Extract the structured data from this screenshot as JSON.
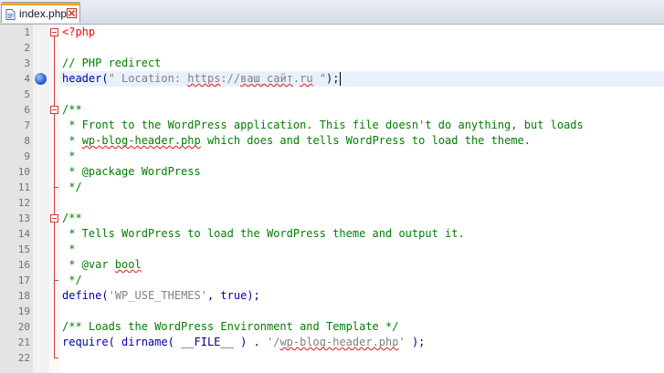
{
  "tab": {
    "label": "index.php"
  },
  "lines": [
    {
      "n": "1",
      "tokens": [
        {
          "t": "<?php",
          "c": "php"
        }
      ]
    },
    {
      "n": "2",
      "tokens": []
    },
    {
      "n": "3",
      "tokens": [
        {
          "t": "// PHP redirect",
          "c": "cmt"
        }
      ]
    },
    {
      "n": "4",
      "tokens": [
        {
          "t": "header",
          "c": "kw"
        },
        {
          "t": "(",
          "c": "op"
        },
        {
          "t": "\" Location: ",
          "c": "str"
        },
        {
          "t": "https",
          "c": "str sq"
        },
        {
          "t": "://",
          "c": "str"
        },
        {
          "t": "ваш_сайт",
          "c": "str sq"
        },
        {
          "t": ".",
          "c": "str"
        },
        {
          "t": "ru",
          "c": "str sq"
        },
        {
          "t": " \"",
          "c": "str"
        },
        {
          "t": ");",
          "c": "op"
        }
      ]
    },
    {
      "n": "5",
      "tokens": []
    },
    {
      "n": "6",
      "tokens": [
        {
          "t": "/**",
          "c": "cmt"
        }
      ]
    },
    {
      "n": "7",
      "tokens": [
        {
          "t": " * Front to the WordPress application. This file doesn't do anything, but loads",
          "c": "cmt"
        }
      ]
    },
    {
      "n": "8",
      "tokens": [
        {
          "t": " * ",
          "c": "cmt"
        },
        {
          "t": "wp-blog-header.php",
          "c": "cmt sq"
        },
        {
          "t": " which does and tells WordPress to load the theme.",
          "c": "cmt"
        }
      ]
    },
    {
      "n": "9",
      "tokens": [
        {
          "t": " *",
          "c": "cmt"
        }
      ]
    },
    {
      "n": "10",
      "tokens": [
        {
          "t": " * @package WordPress",
          "c": "cmt"
        }
      ]
    },
    {
      "n": "11",
      "tokens": [
        {
          "t": " */",
          "c": "cmt"
        }
      ]
    },
    {
      "n": "12",
      "tokens": []
    },
    {
      "n": "13",
      "tokens": [
        {
          "t": "/**",
          "c": "cmt"
        }
      ]
    },
    {
      "n": "14",
      "tokens": [
        {
          "t": " * Tells WordPress to load the WordPress theme and output it.",
          "c": "cmt"
        }
      ]
    },
    {
      "n": "15",
      "tokens": [
        {
          "t": " *",
          "c": "cmt"
        }
      ]
    },
    {
      "n": "16",
      "tokens": [
        {
          "t": " * @var ",
          "c": "cmt"
        },
        {
          "t": "bool",
          "c": "cmt sq"
        }
      ]
    },
    {
      "n": "17",
      "tokens": [
        {
          "t": " */",
          "c": "cmt"
        }
      ]
    },
    {
      "n": "18",
      "tokens": [
        {
          "t": "define",
          "c": "kw"
        },
        {
          "t": "(",
          "c": "op"
        },
        {
          "t": "'WP_USE_THEMES'",
          "c": "str"
        },
        {
          "t": ", ",
          "c": "op"
        },
        {
          "t": "true",
          "c": "kw"
        },
        {
          "t": ");",
          "c": "op"
        }
      ]
    },
    {
      "n": "19",
      "tokens": []
    },
    {
      "n": "20",
      "tokens": [
        {
          "t": "/** Loads the WordPress Environment and Template */",
          "c": "cmt"
        }
      ]
    },
    {
      "n": "21",
      "tokens": [
        {
          "t": "require",
          "c": "kw"
        },
        {
          "t": "( ",
          "c": "op"
        },
        {
          "t": "dirname",
          "c": "kw"
        },
        {
          "t": "( ",
          "c": "op"
        },
        {
          "t": "__FILE__",
          "c": "const"
        },
        {
          "t": " ) . ",
          "c": "op"
        },
        {
          "t": "'/",
          "c": "str"
        },
        {
          "t": "wp-blog-header.php",
          "c": "str sq"
        },
        {
          "t": "'",
          "c": "str"
        },
        {
          "t": " );",
          "c": "op"
        }
      ]
    },
    {
      "n": "22",
      "tokens": []
    }
  ],
  "current_line": "4",
  "bookmark_line": "4",
  "fold_blocks": [
    {
      "start": "1",
      "end": "22"
    },
    {
      "start": "6",
      "end": "11"
    },
    {
      "start": "13",
      "end": "17"
    }
  ],
  "colors": {
    "tab_accent": "#f7a51b",
    "keyword": "#0000aa",
    "comment": "#008000",
    "string": "#808080",
    "php_tag": "#ff0000",
    "current_line": "#eaf0fb"
  }
}
